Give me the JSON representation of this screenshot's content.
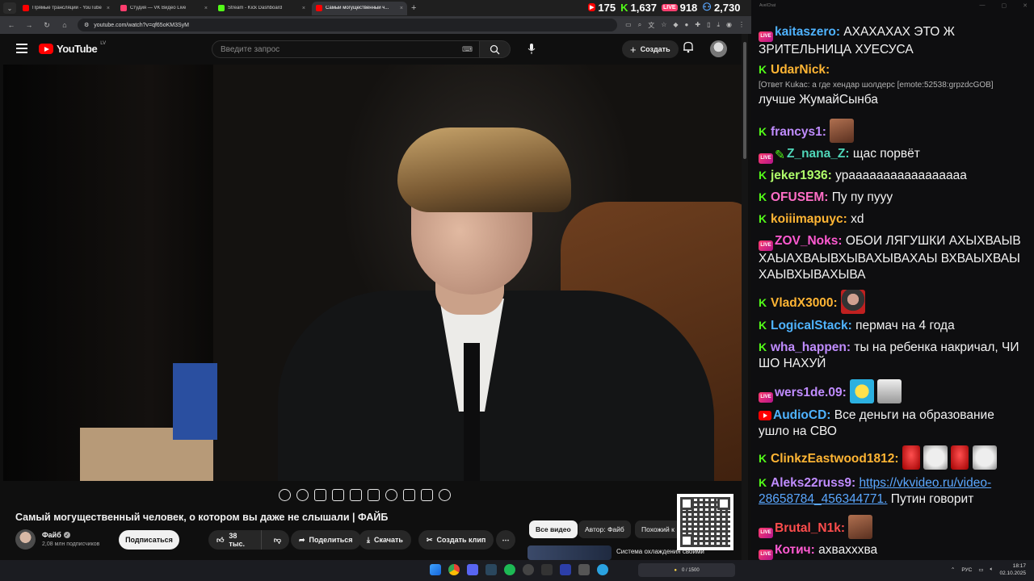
{
  "browser": {
    "tabs": [
      {
        "label": "Прямые трансляции - YouTube",
        "color": "#ff0000"
      },
      {
        "label": "Студия — VK Видео Live",
        "color": "#ff3d6e"
      },
      {
        "label": "Stream - Kick Dashboard",
        "color": "#53fc18"
      },
      {
        "label": "Самый могущественный ч...",
        "color": "#ff0000",
        "active": true
      }
    ],
    "url": "youtube.com/watch?v=qf65oKM3SyM"
  },
  "stream_stats": [
    {
      "platform": "youtube",
      "value": "175",
      "color": "#ff0000"
    },
    {
      "platform": "kick",
      "value": "1,637",
      "color": "#53fc18"
    },
    {
      "platform": "vk",
      "value": "918",
      "color": "#ff3d6e"
    },
    {
      "platform": "total",
      "value": "2,730",
      "color": "#5aa7ff"
    }
  ],
  "youtube": {
    "logo_text": "YouTube",
    "region": "LV",
    "search_placeholder": "Введите запрос",
    "create_label": "Создать"
  },
  "video": {
    "title": "Самый могущественный человек, о котором вы даже не слышали | ФАЙБ",
    "channel": "Файб",
    "subscribers": "2,08 млн подписчиков",
    "subscribe_label": "Подписаться",
    "likes": "38 тыс.",
    "share_label": "Поделиться",
    "download_label": "Скачать",
    "clip_label": "Создать клип"
  },
  "chips": [
    "Все видео",
    "Автор: Файб",
    "Похожий к"
  ],
  "recommended": {
    "title": "Система охлаждения своими"
  },
  "chat": {
    "window_title": "AvelChat",
    "messages": [
      {
        "badges": [
          "vk"
        ],
        "user": "kaitaszero:",
        "color": "#4fb3ff",
        "text": "АХАХАХАХ ЭТО Ж ЗРИТЕЛЬНИЦА ХУЕСУСА"
      },
      {
        "badges": [
          "kick"
        ],
        "user": "UdarNick:",
        "color": "#ffb534",
        "reply": "[Ответ Kukac: а где хендар шолдерс [emote:52538:grpzdcGOB]",
        "text": "лучше ЖумайСынба"
      },
      {
        "badges": [
          "kick"
        ],
        "user": "francys1:",
        "color": "#c08cff",
        "text": ""
      },
      {
        "badges": [
          "vk",
          "pencil"
        ],
        "user": "Z_nana_Z:",
        "color": "#4fd6b8",
        "text": "щас порвёт"
      },
      {
        "badges": [
          "kick"
        ],
        "user": "jeker1936:",
        "color": "#b0ff6a",
        "text": "урааааааааааааааааа"
      },
      {
        "badges": [
          "kick"
        ],
        "user": "OFUSEM:",
        "color": "#ff6ec7",
        "text": "Пу пу пууу"
      },
      {
        "badges": [
          "kick"
        ],
        "user": "koiiimapuyc:",
        "color": "#ffb534",
        "text": "xd"
      },
      {
        "badges": [
          "vk"
        ],
        "user": "ZOV_Noks:",
        "color": "#ff5ad1",
        "text": "ОБОИ ЛЯГУШКИ АХЫХВАЫВХАЫАХВАЫВХЫВАХЫВАХАЫ ВХВАЫХВАЫХАЫВХЫВАХЫВА"
      },
      {
        "badges": [
          "kick"
        ],
        "user": "VladX3000:",
        "color": "#ffb534",
        "text": ""
      },
      {
        "badges": [
          "kick"
        ],
        "user": "LogicalStack:",
        "color": "#4fb3ff",
        "text": "пермач на 4 года"
      },
      {
        "badges": [
          "kick"
        ],
        "user": "wha_happen:",
        "color": "#c08cff",
        "text": "ты на ребенка накричал, ЧИ ШО НАХУЙ"
      },
      {
        "badges": [
          "vk"
        ],
        "user": "wers1de.09:",
        "color": "#c08cff",
        "text": ""
      },
      {
        "badges": [
          "yt"
        ],
        "user": "AudioCD:",
        "color": "#4fb3ff",
        "text": "Все деньги на образование ушло на СВО"
      },
      {
        "badges": [
          "kick"
        ],
        "user": "ClinkzEastwood1812:",
        "color": "#ffb534",
        "text": ""
      },
      {
        "badges": [
          "kick"
        ],
        "user": "Aleks22russ9:",
        "color": "#c08cff",
        "link": "https://vkvideo.ru/video-28658784_456344771.",
        "text": "Путин говорит"
      },
      {
        "badges": [
          "vk"
        ],
        "user": "Brutal_N1k:",
        "color": "#ff4d4d",
        "text": ""
      },
      {
        "badges": [
          "vk"
        ],
        "user": "Котич:",
        "color": "#ff5ad1",
        "text": "ахвахххва"
      }
    ]
  },
  "taskbar": {
    "obs_status": "0 / 1500",
    "lang": "РУС",
    "time": "18:17",
    "date": "02.10.2025"
  }
}
